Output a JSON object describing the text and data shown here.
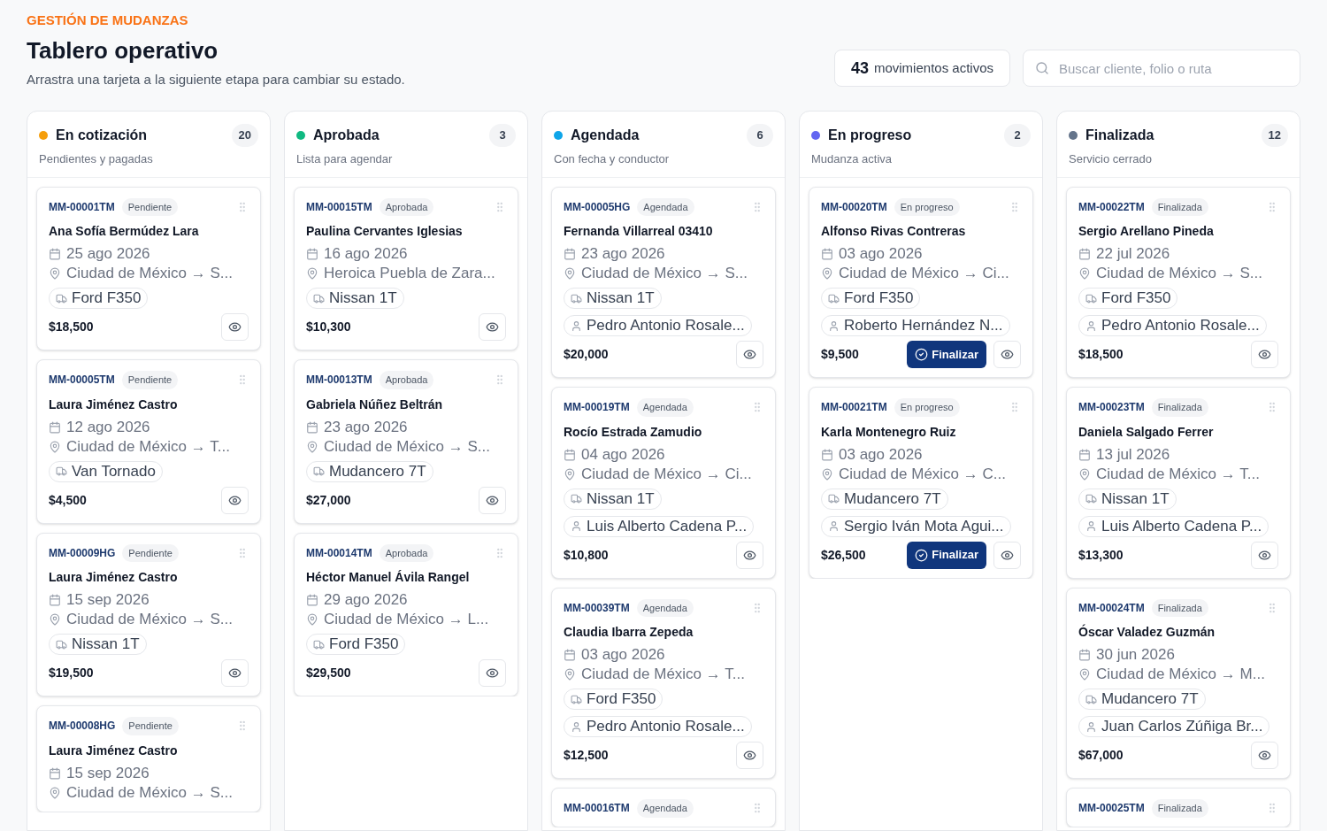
{
  "header": {
    "eyebrow": "GESTIÓN DE MUDANZAS",
    "title": "Tablero operativo",
    "subtitle": "Arrastra una tarjeta a la siguiente etapa para cambiar su estado.",
    "counter": {
      "number": "43",
      "label": "movimientos activos"
    },
    "search": {
      "placeholder": "Buscar cliente, folio o ruta"
    }
  },
  "columns": [
    {
      "title": "En cotización",
      "subtitle": "Pendientes y pagadas",
      "count": "20",
      "color": "#f59e0b",
      "cards": [
        {
          "folio": "MM-00001TM",
          "status": "Pendiente",
          "client": "Ana Sofía Bermúdez Lara",
          "date": "25 ago 2026",
          "route": "Ciudad de México → S...",
          "vehicle": "Ford F350",
          "price": "$18,500"
        },
        {
          "folio": "MM-00005TM",
          "status": "Pendiente",
          "client": "Laura Jiménez Castro",
          "date": "12 ago 2026",
          "route": "Ciudad de México → T...",
          "vehicle": "Van Tornado",
          "price": "$4,500"
        },
        {
          "folio": "MM-00009HG",
          "status": "Pendiente",
          "client": "Laura Jiménez Castro",
          "date": "15 sep 2026",
          "route": "Ciudad de México → S...",
          "vehicle": "Nissan 1T",
          "price": "$19,500"
        },
        {
          "folio": "MM-00008HG",
          "status": "Pendiente",
          "client": "Laura Jiménez Castro",
          "date": "15 sep 2026",
          "route": "Ciudad de México → S..."
        }
      ]
    },
    {
      "title": "Aprobada",
      "subtitle": "Lista para agendar",
      "count": "3",
      "color": "#10b981",
      "cards": [
        {
          "folio": "MM-00015TM",
          "status": "Aprobada",
          "client": "Paulina Cervantes Iglesias",
          "date": "16 ago 2026",
          "route": "Heroica Puebla de Zara...",
          "vehicle": "Nissan 1T",
          "price": "$10,300"
        },
        {
          "folio": "MM-00013TM",
          "status": "Aprobada",
          "client": "Gabriela Núñez Beltrán",
          "date": "23 ago 2026",
          "route": "Ciudad de México → S...",
          "vehicle": "Mudancero 7T",
          "price": "$27,000"
        },
        {
          "folio": "MM-00014TM",
          "status": "Aprobada",
          "client": "Héctor Manuel Ávila Rangel",
          "date": "29 ago 2026",
          "route": "Ciudad de México → L...",
          "vehicle": "Ford F350",
          "price": "$29,500"
        }
      ]
    },
    {
      "title": "Agendada",
      "subtitle": "Con fecha y conductor",
      "count": "6",
      "color": "#0ea5e9",
      "cards": [
        {
          "folio": "MM-00005HG",
          "status": "Agendada",
          "client": "Fernanda Villarreal 03410",
          "date": "23 ago 2026",
          "route": "Ciudad de México → S...",
          "vehicle": "Nissan 1T",
          "driver": "Pedro Antonio Rosale...",
          "price": "$20,000"
        },
        {
          "folio": "MM-00019TM",
          "status": "Agendada",
          "client": "Rocío Estrada Zamudio",
          "date": "04 ago 2026",
          "route": "Ciudad de México → Ci...",
          "vehicle": "Nissan 1T",
          "driver": "Luis Alberto Cadena P...",
          "price": "$10,800"
        },
        {
          "folio": "MM-00039TM",
          "status": "Agendada",
          "client": "Claudia Ibarra Zepeda",
          "date": "03 ago 2026",
          "route": "Ciudad de México → T...",
          "vehicle": "Ford F350",
          "driver": "Pedro Antonio Rosale...",
          "price": "$12,500"
        },
        {
          "folio": "MM-00016TM",
          "status": "Agendada"
        }
      ]
    },
    {
      "title": "En progreso",
      "subtitle": "Mudanza activa",
      "count": "2",
      "color": "#6366f1",
      "cards": [
        {
          "folio": "MM-00020TM",
          "status": "En progreso",
          "client": "Alfonso Rivas Contreras",
          "date": "03 ago 2026",
          "route": "Ciudad de México → Ci...",
          "vehicle": "Ford F350",
          "driver": "Roberto Hernández N...",
          "price": "$9,500",
          "action": "Finalizar"
        },
        {
          "folio": "MM-00021TM",
          "status": "En progreso",
          "client": "Karla Montenegro Ruiz",
          "date": "03 ago 2026",
          "route": "Ciudad de México → C...",
          "vehicle": "Mudancero 7T",
          "driver": "Sergio Iván Mota Agui...",
          "price": "$26,500",
          "action": "Finalizar"
        }
      ]
    },
    {
      "title": "Finalizada",
      "subtitle": "Servicio cerrado",
      "count": "12",
      "color": "#64748b",
      "cards": [
        {
          "folio": "MM-00022TM",
          "status": "Finalizada",
          "client": "Sergio Arellano Pineda",
          "date": "22 jul 2026",
          "route": "Ciudad de México → S...",
          "vehicle": "Ford F350",
          "driver": "Pedro Antonio Rosale...",
          "price": "$18,500"
        },
        {
          "folio": "MM-00023TM",
          "status": "Finalizada",
          "client": "Daniela Salgado Ferrer",
          "date": "13 jul 2026",
          "route": "Ciudad de México → T...",
          "vehicle": "Nissan 1T",
          "driver": "Luis Alberto Cadena P...",
          "price": "$13,300"
        },
        {
          "folio": "MM-00024TM",
          "status": "Finalizada",
          "client": "Óscar Valadez Guzmán",
          "date": "30 jun 2026",
          "route": "Ciudad de México → M...",
          "vehicle": "Mudancero 7T",
          "driver": "Juan Carlos Zúñiga Br...",
          "price": "$67,000"
        },
        {
          "folio": "MM-00025TM",
          "status": "Finalizada"
        }
      ]
    }
  ]
}
